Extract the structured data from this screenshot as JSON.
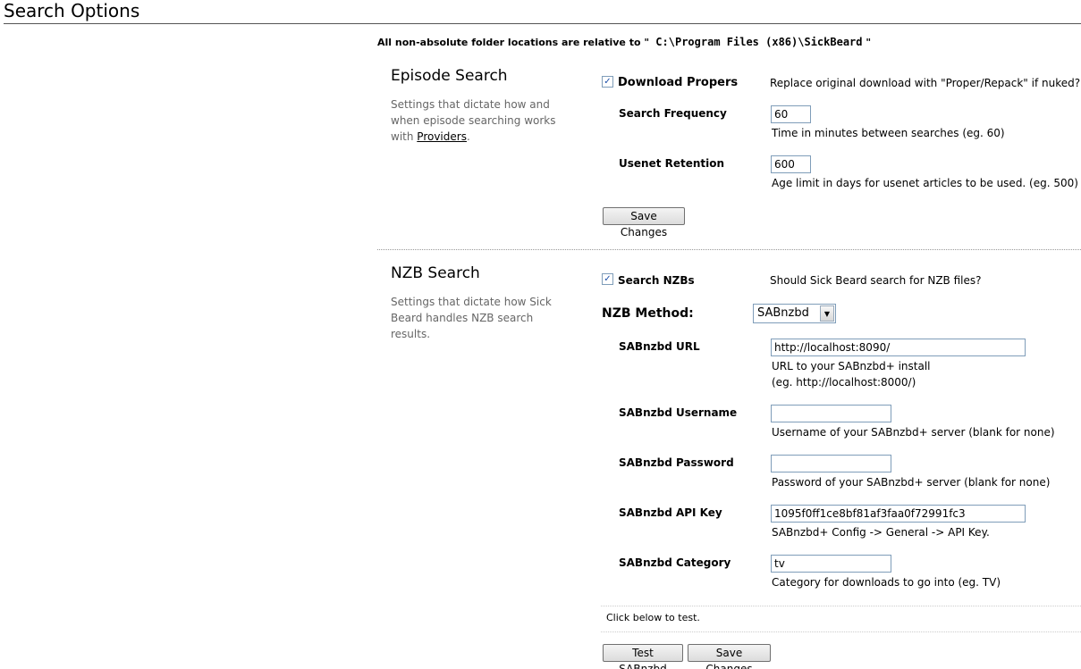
{
  "page": {
    "title": "Search Options",
    "path_note_prefix": "All non-absolute folder locations are relative to \"",
    "path_note_path": " C:\\Program Files (x86)\\SickBeard",
    "path_note_suffix": " \""
  },
  "episode_search": {
    "title": "Episode Search",
    "desc_text": "Settings that dictate how and when episode searching works with",
    "desc_link": "Providers",
    "desc_end": ".",
    "download_propers": {
      "label": "Download Propers",
      "checked": true,
      "help": "Replace original download with \"Proper/Repack\" if nuked?"
    },
    "search_frequency": {
      "label": "Search Frequency",
      "value": "60",
      "help": "Time in minutes between searches (eg. 60)"
    },
    "usenet_retention": {
      "label": "Usenet Retention",
      "value": "600",
      "help": "Age limit in days for usenet articles to be used. (eg. 500)"
    },
    "save_label": "Save Changes"
  },
  "nzb_search": {
    "title": "NZB Search",
    "desc": "Settings that dictate how Sick Beard handles NZB search results.",
    "search_nzbs": {
      "label": "Search NZBs",
      "checked": true,
      "help": "Should Sick Beard search for NZB files?"
    },
    "nzb_method": {
      "label": "NZB Method:",
      "selected": "SABnzbd"
    },
    "sab_url": {
      "label": "SABnzbd URL",
      "value": "http://localhost:8090/",
      "help_line1": "URL to your SABnzbd+ install",
      "help_line2": "(eg. http://localhost:8000/)"
    },
    "sab_username": {
      "label": "SABnzbd Username",
      "value": "",
      "help": "Username of your SABnzbd+ server (blank for none)"
    },
    "sab_password": {
      "label": "SABnzbd Password",
      "value": "",
      "help": "Password of your SABnzbd+ server (blank for none)"
    },
    "sab_apikey": {
      "label": "SABnzbd API Key",
      "value": "1095f0ff1ce8bf81af3faa0f72991fc3",
      "help": "SABnzbd+ Config -> General -> API Key."
    },
    "sab_category": {
      "label": "SABnzbd Category",
      "value": "tv",
      "help": "Category for downloads to go into (eg. TV)"
    },
    "test_note": "Click below to test.",
    "test_label": "Test SABnzbd",
    "save_label": "Save Changes"
  },
  "icons": {
    "checkbox_checked": "checkmark-icon",
    "select_arrow": "chevron-down-icon"
  }
}
